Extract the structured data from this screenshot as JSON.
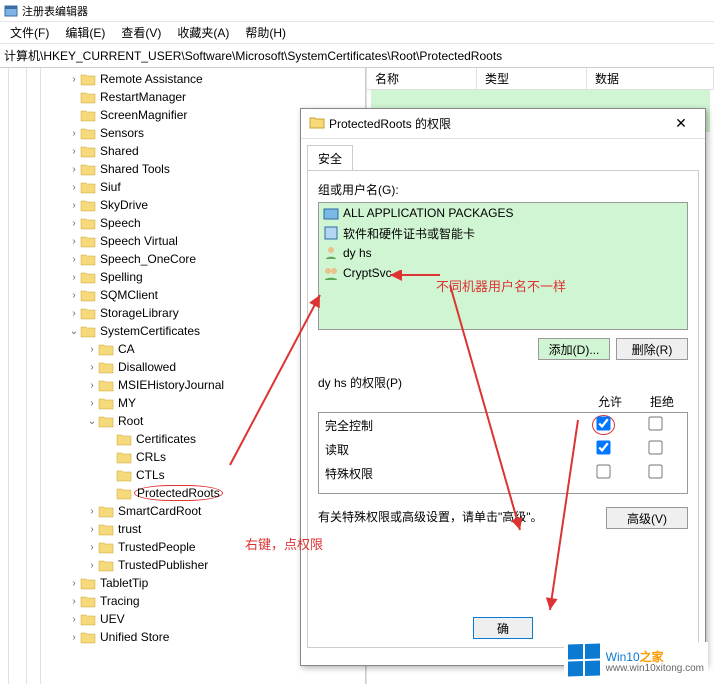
{
  "app": {
    "title": "注册表编辑器"
  },
  "menu": {
    "file": "文件(F)",
    "edit": "编辑(E)",
    "view": "查看(V)",
    "fav": "收藏夹(A)",
    "help": "帮助(H)"
  },
  "address": "计算机\\HKEY_CURRENT_USER\\Software\\Microsoft\\SystemCertificates\\Root\\ProtectedRoots",
  "list_header": {
    "name": "名称",
    "type": "类型",
    "data": "数据"
  },
  "tree": {
    "items": [
      {
        "label": "Remote Assistance",
        "indent": 68,
        "exp": ">"
      },
      {
        "label": "RestartManager",
        "indent": 68,
        "exp": ""
      },
      {
        "label": "ScreenMagnifier",
        "indent": 68,
        "exp": ""
      },
      {
        "label": "Sensors",
        "indent": 68,
        "exp": ">"
      },
      {
        "label": "Shared",
        "indent": 68,
        "exp": ">"
      },
      {
        "label": "Shared Tools",
        "indent": 68,
        "exp": ">"
      },
      {
        "label": "Siuf",
        "indent": 68,
        "exp": ">"
      },
      {
        "label": "SkyDrive",
        "indent": 68,
        "exp": ">"
      },
      {
        "label": "Speech",
        "indent": 68,
        "exp": ">"
      },
      {
        "label": "Speech Virtual",
        "indent": 68,
        "exp": ">"
      },
      {
        "label": "Speech_OneCore",
        "indent": 68,
        "exp": ">"
      },
      {
        "label": "Spelling",
        "indent": 68,
        "exp": ">"
      },
      {
        "label": "SQMClient",
        "indent": 68,
        "exp": ">"
      },
      {
        "label": "StorageLibrary",
        "indent": 68,
        "exp": ">"
      },
      {
        "label": "SystemCertificates",
        "indent": 68,
        "exp": "v"
      },
      {
        "label": "CA",
        "indent": 86,
        "exp": ">"
      },
      {
        "label": "Disallowed",
        "indent": 86,
        "exp": ">"
      },
      {
        "label": "MSIEHistoryJournal",
        "indent": 86,
        "exp": ">"
      },
      {
        "label": "MY",
        "indent": 86,
        "exp": ">"
      },
      {
        "label": "Root",
        "indent": 86,
        "exp": "v"
      },
      {
        "label": "Certificates",
        "indent": 104,
        "exp": ""
      },
      {
        "label": "CRLs",
        "indent": 104,
        "exp": ""
      },
      {
        "label": "CTLs",
        "indent": 104,
        "exp": ""
      },
      {
        "label": "ProtectedRoots",
        "indent": 104,
        "exp": "",
        "highlight": true
      },
      {
        "label": "SmartCardRoot",
        "indent": 86,
        "exp": ">"
      },
      {
        "label": "trust",
        "indent": 86,
        "exp": ">"
      },
      {
        "label": "TrustedPeople",
        "indent": 86,
        "exp": ">"
      },
      {
        "label": "TrustedPublisher",
        "indent": 86,
        "exp": ">"
      },
      {
        "label": "TabletTip",
        "indent": 68,
        "exp": ">"
      },
      {
        "label": "Tracing",
        "indent": 68,
        "exp": ">"
      },
      {
        "label": "UEV",
        "indent": 68,
        "exp": ">"
      },
      {
        "label": "Unified Store",
        "indent": 68,
        "exp": ">"
      }
    ]
  },
  "dialog": {
    "title": "ProtectedRoots 的权限",
    "tab": "安全",
    "groups_label": "组或用户名(G):",
    "principals": [
      "ALL APPLICATION PACKAGES",
      "软件和硬件证书或智能卡",
      "dy hs",
      "CryptSvc"
    ],
    "add_btn": "添加(D)...",
    "remove_btn": "删除(R)",
    "perm_label": "dy hs 的权限(P)",
    "col_allow": "允许",
    "col_deny": "拒绝",
    "perms": [
      {
        "name": "完全控制",
        "allow": true,
        "deny": false
      },
      {
        "name": "读取",
        "allow": true,
        "deny": false
      },
      {
        "name": "特殊权限",
        "allow": false,
        "deny": false
      }
    ],
    "footnote": "有关特殊权限或高级设置，请单击\"高级\"。",
    "advanced_btn": "高级(V)",
    "ok_btn": "确"
  },
  "annotations": {
    "right_click": "右键，点权限",
    "diff_machine": "不同机器用户名不一样"
  },
  "watermark": {
    "brand_a": "Win10",
    "brand_b": "之家",
    "url": "www.win10xitong.com"
  }
}
